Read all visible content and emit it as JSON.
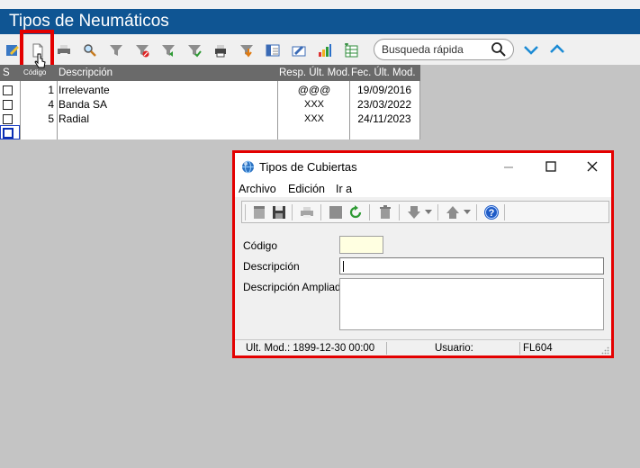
{
  "window": {
    "title": "Tipos de Neumáticos"
  },
  "toolbar": {
    "icons": [
      "edit-icon",
      "new-document-icon",
      "print-icon",
      "search-icon",
      "filter-icon",
      "filter-remove-icon",
      "filter-apply-icon",
      "filter-check-icon",
      "print-preview-icon",
      "export-icon",
      "columns-icon",
      "edit-field-icon",
      "chart-icon",
      "spreadsheet-icon"
    ],
    "search_placeholder": "Busqueda rápida"
  },
  "grid": {
    "columns": [
      "S",
      "Código",
      "Descripción",
      "Resp. Últ. Mod.",
      "Fec. Últ. Mod."
    ],
    "rows": [
      {
        "code": "1",
        "description": "Irrelevante",
        "resp": "@@@",
        "date": "19/09/2016"
      },
      {
        "code": "4",
        "description": "Banda SA",
        "resp": "XXX",
        "date": "23/03/2022"
      },
      {
        "code": "5",
        "description": "Radial",
        "resp": "XXX",
        "date": "24/11/2023"
      }
    ]
  },
  "dialog": {
    "title": "Tipos de Cubiertas",
    "menu": [
      "Archivo",
      "Edición",
      "Ir a"
    ],
    "fields": {
      "codigo_label": "Código",
      "codigo_value": "",
      "descripcion_label": "Descripción",
      "descripcion_value": "",
      "descripcion_ampliada_label": "Descripción Ampliada",
      "descripcion_ampliada_value": ""
    },
    "status": {
      "last_mod": "Ult. Mod.: 1899-12-30 00:00",
      "user": "Usuario:",
      "code": "FL604"
    }
  },
  "colors": {
    "title_bar": "#0f5593",
    "highlight": "#e40000",
    "accent_arrow": "#1a8ad4"
  }
}
